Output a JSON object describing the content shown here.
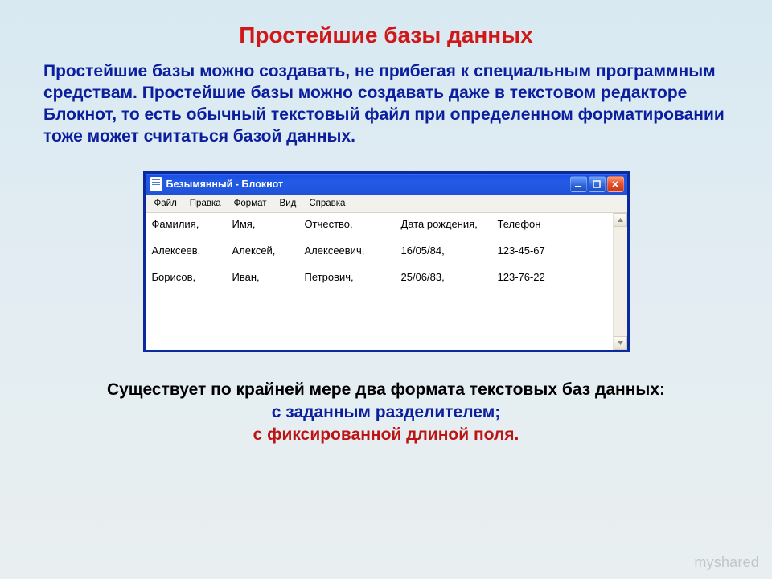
{
  "slide": {
    "title": "Простейшие базы данных",
    "intro": "Простейшие базы можно создавать, не прибегая к специальным программным средствам. Простейшие базы можно создавать даже в текстовом редакторе Блокнот, то есть обычный текстовый файл при определенном форматировании тоже может считаться базой данных."
  },
  "notepad": {
    "window_title": "Безымянный - Блокнот",
    "menu": {
      "file": {
        "pre": "",
        "hot": "Ф",
        "post": "айл"
      },
      "edit": {
        "pre": "",
        "hot": "П",
        "post": "равка"
      },
      "format": {
        "pre": "Фор",
        "hot": "м",
        "post": "ат"
      },
      "view": {
        "pre": "",
        "hot": "В",
        "post": "ид"
      },
      "help": {
        "pre": "",
        "hot": "С",
        "post": "правка"
      }
    },
    "columns": {
      "c1": "Фамилия,",
      "c2": "Имя,",
      "c3": "Отчество,",
      "c4": "Дата рождения,",
      "c5": "Телефон"
    },
    "rows": [
      {
        "c1": "Алексеев,",
        "c2": "Алексей,",
        "c3": "Алексеевич,",
        "c4": "16/05/84,",
        "c5": "123-45-67"
      },
      {
        "c1": "Борисов,",
        "c2": "Иван,",
        "c3": "Петрович,",
        "c4": "25/06/83,",
        "c5": "123-76-22"
      }
    ]
  },
  "formats": {
    "lead": "Существует по крайней мере два формата текстовых баз данных:",
    "line1": "с заданным разделителем;",
    "line2": "с фиксированной длиной поля."
  },
  "watermark": "myshared"
}
